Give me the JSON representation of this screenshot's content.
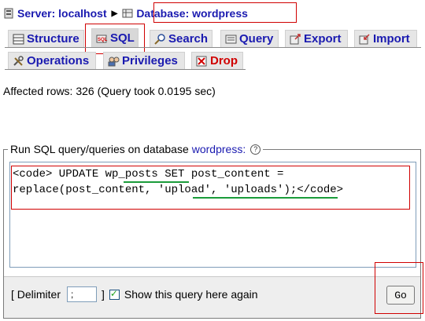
{
  "breadcrumb": {
    "server_label": "Server: localhost",
    "database_label": "Database: wordpress"
  },
  "tabs": [
    {
      "label": "Structure",
      "icon": "structure-icon"
    },
    {
      "label": "SQL",
      "icon": "sql-icon",
      "active": true
    },
    {
      "label": "Search",
      "icon": "search-icon"
    },
    {
      "label": "Query",
      "icon": "query-icon"
    },
    {
      "label": "Export",
      "icon": "export-icon"
    },
    {
      "label": "Import",
      "icon": "import-icon"
    },
    {
      "label": "Operations",
      "icon": "operations-icon"
    },
    {
      "label": "Privileges",
      "icon": "privileges-icon"
    },
    {
      "label": "Drop",
      "icon": "drop-icon"
    }
  ],
  "result": {
    "text": "Affected rows: 326 (Query took 0.0195 sec)"
  },
  "sql_panel": {
    "legend": "Run SQL query/queries on database",
    "database": "wordpress:",
    "help": "?",
    "query_line1": "<code> UPDATE wp_posts SET post_content =",
    "query_line2": "replace(post_content, 'upload', 'uploads');</code>"
  },
  "footer": {
    "delimiter_open": "[ Delimiter",
    "delimiter_value": ";",
    "delimiter_close": "]",
    "show_query_label": "Show this query here again",
    "show_query_checked": true,
    "go_label": "Go"
  },
  "colors": {
    "link": "#1a1ab0",
    "drop": "#d00000",
    "highlight_box": "#d00000",
    "underline": "#1a9b3a"
  }
}
